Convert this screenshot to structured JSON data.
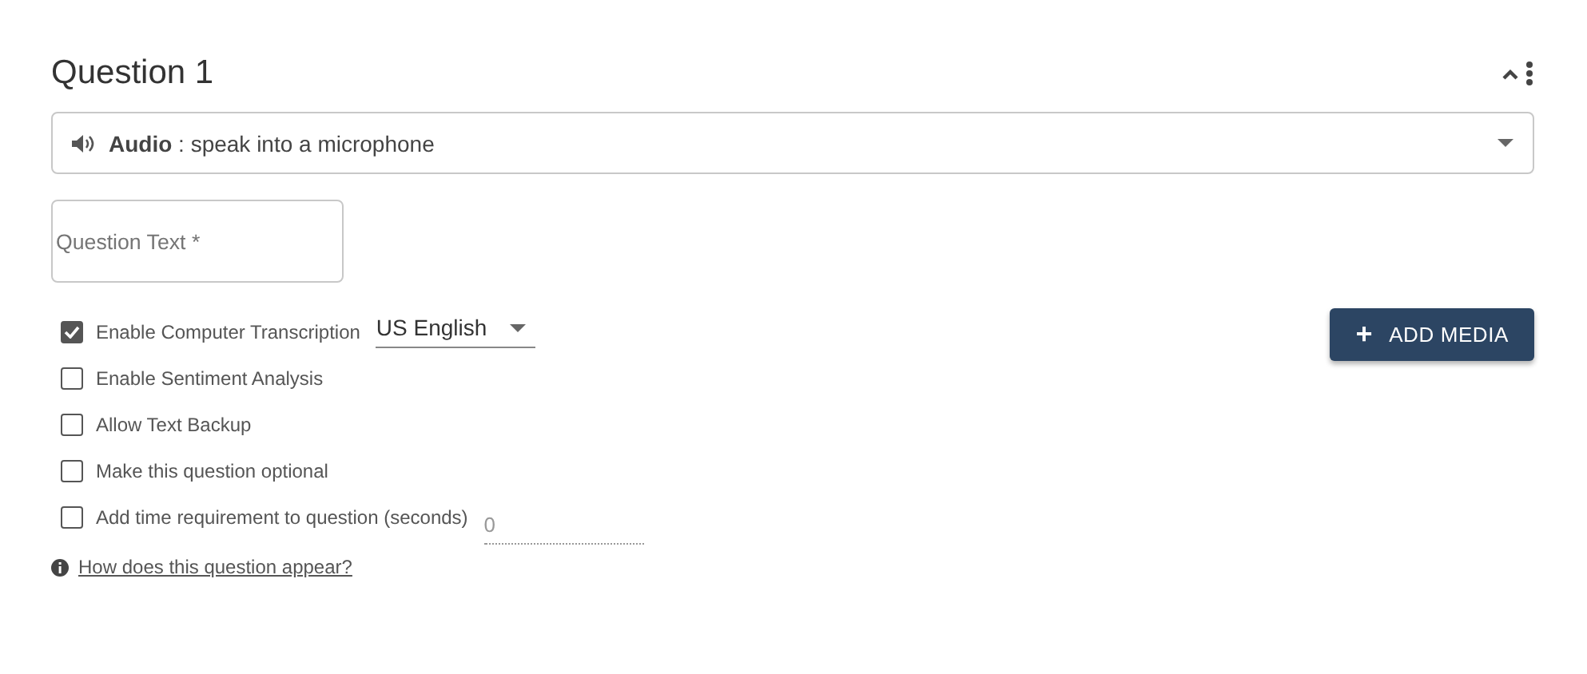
{
  "question": {
    "title": "Question 1",
    "expanded": true
  },
  "type_select": {
    "kind": "Audio",
    "description": ": speak into a microphone"
  },
  "question_text": {
    "placeholder": "Question Text *"
  },
  "options": [
    {
      "label": "Enable Computer Transcription",
      "checked": true,
      "language": "US English"
    },
    {
      "label": "Enable Sentiment Analysis",
      "checked": false
    },
    {
      "label": "Allow Text Backup",
      "checked": false
    },
    {
      "label": "Make this question optional",
      "checked": false
    },
    {
      "label": "Add time requirement to question (seconds)",
      "checked": false,
      "time_field": {
        "value": "0",
        "disabled": true
      }
    }
  ],
  "add_media_button": {
    "icon": "+",
    "label": "ADD MEDIA"
  },
  "help_link": "How does this question appear?"
}
